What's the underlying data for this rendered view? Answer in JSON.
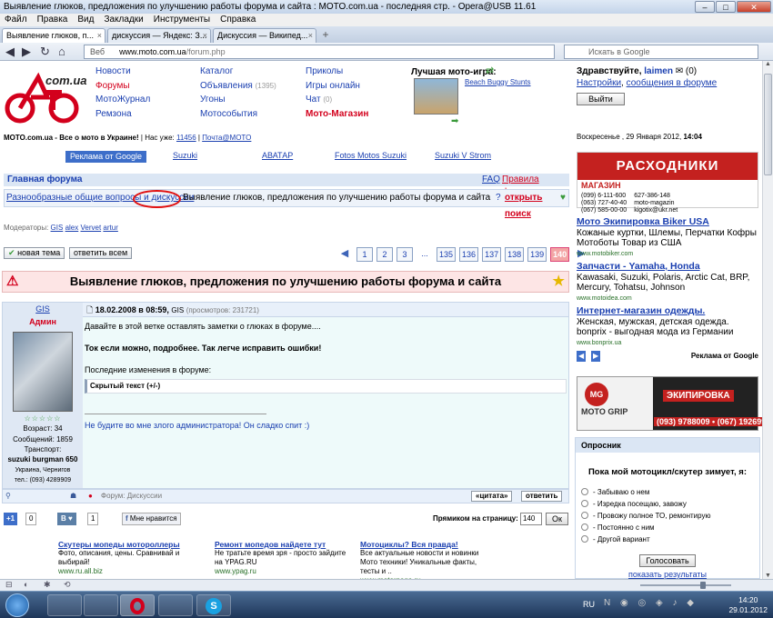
{
  "window": {
    "title": "Выявление глюков, предложения по улучшению работы форума и сайта : MOTO.com.ua - последняя стр. - Opera@USB 11.61",
    "controls": [
      "minimize-icon",
      "maximize-icon",
      "close-icon"
    ]
  },
  "menu": [
    "Файл",
    "Правка",
    "Вид",
    "Закладки",
    "Инструменты",
    "Справка"
  ],
  "tabs": [
    {
      "label": "Выявление глюков, п...",
      "active": true
    },
    {
      "label": "дискуссия — Яндекс: З...",
      "active": false
    },
    {
      "label": "Дискуссия — Википед...",
      "active": false
    }
  ],
  "addressbar": {
    "prefix": "Веб",
    "host": "www.moto.com.ua",
    "path": "/forum.php",
    "search_placeholder": "Искать в Google"
  },
  "site": {
    "logo_text": "com.ua",
    "nav_col1": [
      "Новости",
      "Форумы",
      "МотоЖурнал",
      "Ремзона"
    ],
    "nav_col2": [
      "Каталог",
      "Объявления",
      "Угоны",
      "Мотособытия"
    ],
    "nav_col2_count": "(1395)",
    "nav_col3": [
      "Приколы",
      "Игры онлайн",
      "Чат",
      "Мото-Магазин"
    ],
    "chat_count": "(0)",
    "game_title": "Лучшая мото-игра:",
    "game_name": "Beach Buggy Stunts",
    "greeting": "Здравствуйте,",
    "username": "laimen",
    "msg_count": "(0)",
    "settings_link": "Настройки",
    "messages_link": "сообщения в форуме",
    "logout_button": "Выйти",
    "tagline": "MOTO.com.ua - Все о мото в Украине!",
    "online_label": "Нас уже:",
    "online_count": "11456",
    "mail_link": "Почта@MOTO",
    "date": "Воскресенье , 29 Января 2012,",
    "time": "14:04"
  },
  "linkbar": [
    "Реклама от Google",
    "Suzuki",
    "АВАТАР",
    "Fotos Motos Suzuki",
    "Suzuki V Strom"
  ],
  "forum": {
    "home": "Главная форума",
    "faq": "FAQ",
    "rules": "Правила форума",
    "breadcrumb_parent": "Разнообразные общие вопросы и дискуссии",
    "breadcrumb_current": "Выявление глюков, предложения по улучшению работы форума и сайта",
    "search_help": "?",
    "open_search": "открыть поиск",
    "moderators_label": "Модераторы:",
    "moderators": [
      "GIS",
      "alex",
      "Vervet",
      "artur"
    ],
    "new_topic": "новая тема",
    "reply_all": "ответить всем",
    "pages": [
      "1",
      "2",
      "3",
      "...",
      "135",
      "136",
      "137",
      "138",
      "139",
      "140"
    ],
    "current_page": "140",
    "thread_title": "Выявление глюков, предложения по улучшению работы форума и сайта"
  },
  "post": {
    "author": "GIS",
    "role": "Админ",
    "rating_stars": 5,
    "age": "Возраст: 34",
    "messages": "Сообщений: 1859",
    "transport_label": "Транспорт:",
    "transport": "suzuki burgman 650",
    "location": "Украина, Чернигов",
    "phone": "тел.: (093) 4289909",
    "date": "18.02.2008 в 08:59,",
    "date_author": "GIS",
    "views": "(просмотров: 231721)",
    "body_line1": "Давайте в этой ветке оставлять заметки о глюках в форуме....",
    "body_line2": "Ток если можно, подробнее. Так легче исправить ошибки!",
    "body_line3": "Последние изменения в форуме:",
    "spoiler": "Скрытый текст (+/-)",
    "signature": "Не будите во мне злого администратора! Он сладко спит :)",
    "forum_label": "Форум: Дискуссии",
    "quote_button": "«цитата»",
    "reply_button": "ответить"
  },
  "social": {
    "plus_count": "0",
    "vk_count": "1",
    "fb_like": "Мне нравится",
    "jump_label": "Прямиком на страницу:",
    "jump_value": "140",
    "jump_button": "Ок"
  },
  "ads_bottom": [
    {
      "title": "Скутеры мопеды мотороллеры",
      "text": "Фото, описания, цены. Сравнивай и выбирай!",
      "url": "www.ru.all.biz"
    },
    {
      "title": "Ремонт мопедов найдете тут",
      "text": "Не тратьте время зря - просто зайдите на YPAG.RU",
      "url": "www.ypag.ru"
    },
    {
      "title": "Мотоциклы? Вся правда!",
      "text": "Все актуальные новости и новинки Мото техники! Уникальные факты, тесты и ..",
      "url": "www.motorpage.ru"
    }
  ],
  "right_banner": {
    "title": "РАСХОДНИКИ",
    "brand": "МАГАЗИН",
    "phones": [
      "(099) 6-111-600",
      "(063) 727-40-40",
      "(067) 585-00-00"
    ],
    "phones2": [
      "627-386-148",
      "moto-magazin",
      "kigotix@ukr.net"
    ]
  },
  "adsense": [
    {
      "title": "Мото Экипировка Biker USA",
      "text": "Кожаные куртки, Шлемы, Перчатки Кофры Мотоботы Товар из США",
      "url": "www.motobiker.com"
    },
    {
      "title": "Запчасти - Yamaha, Honda",
      "text": "Kawasaki, Suzuki, Polaris, Arctic Cat, BRP, Mercury, Tohatsu, Johnson",
      "url": "www.motoidea.com"
    },
    {
      "title": "Интернет-магазин одежды.",
      "text": "Женская, мужская, детская одежда. bonprix - выгодная мода из Германии",
      "url": "www.bonprix.ua"
    }
  ],
  "adsense_by": "Реклама от Google",
  "mg_banner": {
    "brand": "MOTO GRIP",
    "title": "ЭКИПИРОВКА",
    "phones": "(093) 9788009 • (067) 1926990"
  },
  "poll": {
    "header": "Опросник",
    "question": "Пока мой мотоцикл/скутер зимует, я:",
    "options": [
      "- Забываю о нем",
      "- Изредка посещаю, завожу",
      "- Провожу полное ТО, ремонтирую",
      "- Постоянно с ним",
      "- Другой вариант"
    ],
    "vote_button": "Голосовать",
    "results_link": "показать результаты"
  },
  "taskbar": {
    "lang": "RU",
    "time": "14:20",
    "date": "29.01.2012"
  }
}
